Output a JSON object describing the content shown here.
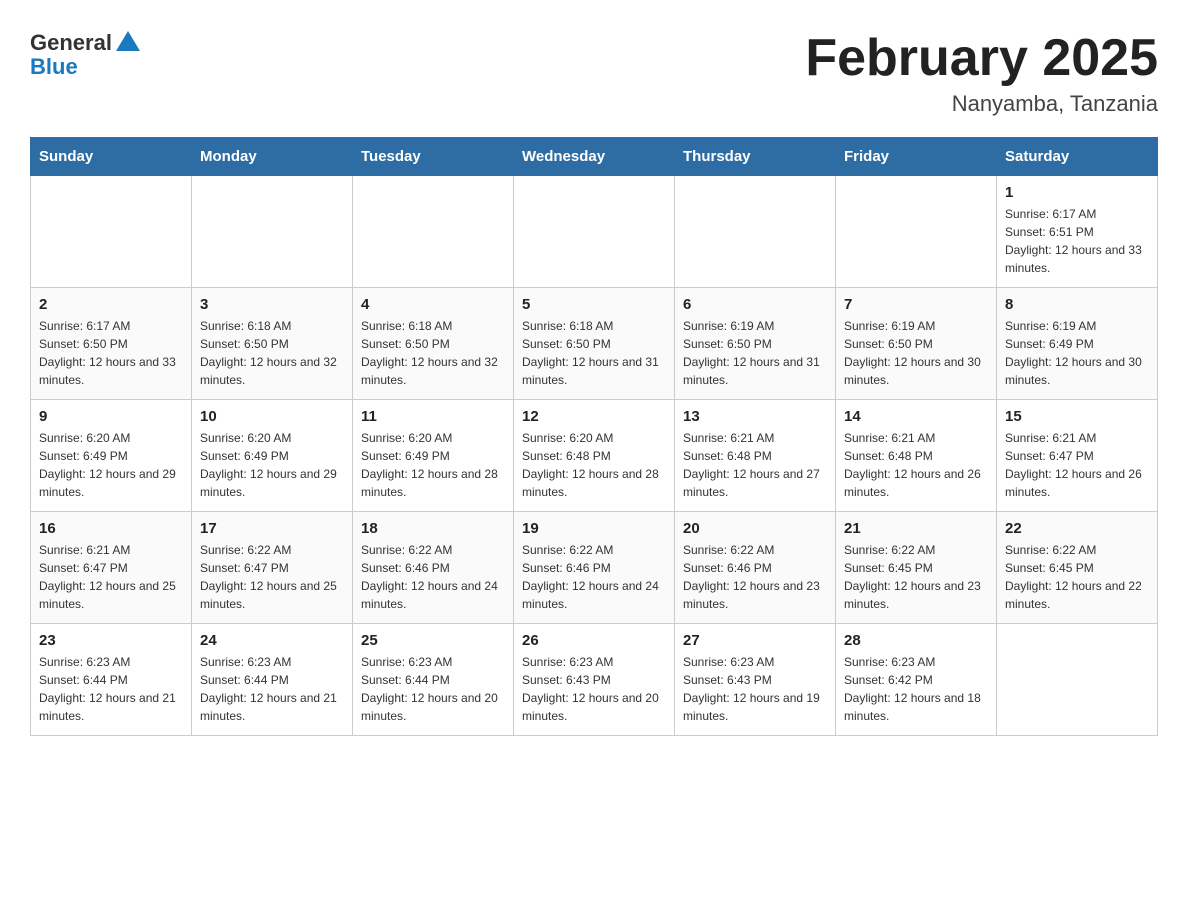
{
  "header": {
    "logo_general": "General",
    "logo_blue": "Blue",
    "title": "February 2025",
    "location": "Nanyamba, Tanzania"
  },
  "days_of_week": [
    "Sunday",
    "Monday",
    "Tuesday",
    "Wednesday",
    "Thursday",
    "Friday",
    "Saturday"
  ],
  "weeks": [
    {
      "days": [
        {
          "number": "",
          "info": ""
        },
        {
          "number": "",
          "info": ""
        },
        {
          "number": "",
          "info": ""
        },
        {
          "number": "",
          "info": ""
        },
        {
          "number": "",
          "info": ""
        },
        {
          "number": "",
          "info": ""
        },
        {
          "number": "1",
          "info": "Sunrise: 6:17 AM\nSunset: 6:51 PM\nDaylight: 12 hours and 33 minutes."
        }
      ]
    },
    {
      "days": [
        {
          "number": "2",
          "info": "Sunrise: 6:17 AM\nSunset: 6:50 PM\nDaylight: 12 hours and 33 minutes."
        },
        {
          "number": "3",
          "info": "Sunrise: 6:18 AM\nSunset: 6:50 PM\nDaylight: 12 hours and 32 minutes."
        },
        {
          "number": "4",
          "info": "Sunrise: 6:18 AM\nSunset: 6:50 PM\nDaylight: 12 hours and 32 minutes."
        },
        {
          "number": "5",
          "info": "Sunrise: 6:18 AM\nSunset: 6:50 PM\nDaylight: 12 hours and 31 minutes."
        },
        {
          "number": "6",
          "info": "Sunrise: 6:19 AM\nSunset: 6:50 PM\nDaylight: 12 hours and 31 minutes."
        },
        {
          "number": "7",
          "info": "Sunrise: 6:19 AM\nSunset: 6:50 PM\nDaylight: 12 hours and 30 minutes."
        },
        {
          "number": "8",
          "info": "Sunrise: 6:19 AM\nSunset: 6:49 PM\nDaylight: 12 hours and 30 minutes."
        }
      ]
    },
    {
      "days": [
        {
          "number": "9",
          "info": "Sunrise: 6:20 AM\nSunset: 6:49 PM\nDaylight: 12 hours and 29 minutes."
        },
        {
          "number": "10",
          "info": "Sunrise: 6:20 AM\nSunset: 6:49 PM\nDaylight: 12 hours and 29 minutes."
        },
        {
          "number": "11",
          "info": "Sunrise: 6:20 AM\nSunset: 6:49 PM\nDaylight: 12 hours and 28 minutes."
        },
        {
          "number": "12",
          "info": "Sunrise: 6:20 AM\nSunset: 6:48 PM\nDaylight: 12 hours and 28 minutes."
        },
        {
          "number": "13",
          "info": "Sunrise: 6:21 AM\nSunset: 6:48 PM\nDaylight: 12 hours and 27 minutes."
        },
        {
          "number": "14",
          "info": "Sunrise: 6:21 AM\nSunset: 6:48 PM\nDaylight: 12 hours and 26 minutes."
        },
        {
          "number": "15",
          "info": "Sunrise: 6:21 AM\nSunset: 6:47 PM\nDaylight: 12 hours and 26 minutes."
        }
      ]
    },
    {
      "days": [
        {
          "number": "16",
          "info": "Sunrise: 6:21 AM\nSunset: 6:47 PM\nDaylight: 12 hours and 25 minutes."
        },
        {
          "number": "17",
          "info": "Sunrise: 6:22 AM\nSunset: 6:47 PM\nDaylight: 12 hours and 25 minutes."
        },
        {
          "number": "18",
          "info": "Sunrise: 6:22 AM\nSunset: 6:46 PM\nDaylight: 12 hours and 24 minutes."
        },
        {
          "number": "19",
          "info": "Sunrise: 6:22 AM\nSunset: 6:46 PM\nDaylight: 12 hours and 24 minutes."
        },
        {
          "number": "20",
          "info": "Sunrise: 6:22 AM\nSunset: 6:46 PM\nDaylight: 12 hours and 23 minutes."
        },
        {
          "number": "21",
          "info": "Sunrise: 6:22 AM\nSunset: 6:45 PM\nDaylight: 12 hours and 23 minutes."
        },
        {
          "number": "22",
          "info": "Sunrise: 6:22 AM\nSunset: 6:45 PM\nDaylight: 12 hours and 22 minutes."
        }
      ]
    },
    {
      "days": [
        {
          "number": "23",
          "info": "Sunrise: 6:23 AM\nSunset: 6:44 PM\nDaylight: 12 hours and 21 minutes."
        },
        {
          "number": "24",
          "info": "Sunrise: 6:23 AM\nSunset: 6:44 PM\nDaylight: 12 hours and 21 minutes."
        },
        {
          "number": "25",
          "info": "Sunrise: 6:23 AM\nSunset: 6:44 PM\nDaylight: 12 hours and 20 minutes."
        },
        {
          "number": "26",
          "info": "Sunrise: 6:23 AM\nSunset: 6:43 PM\nDaylight: 12 hours and 20 minutes."
        },
        {
          "number": "27",
          "info": "Sunrise: 6:23 AM\nSunset: 6:43 PM\nDaylight: 12 hours and 19 minutes."
        },
        {
          "number": "28",
          "info": "Sunrise: 6:23 AM\nSunset: 6:42 PM\nDaylight: 12 hours and 18 minutes."
        },
        {
          "number": "",
          "info": ""
        }
      ]
    }
  ]
}
